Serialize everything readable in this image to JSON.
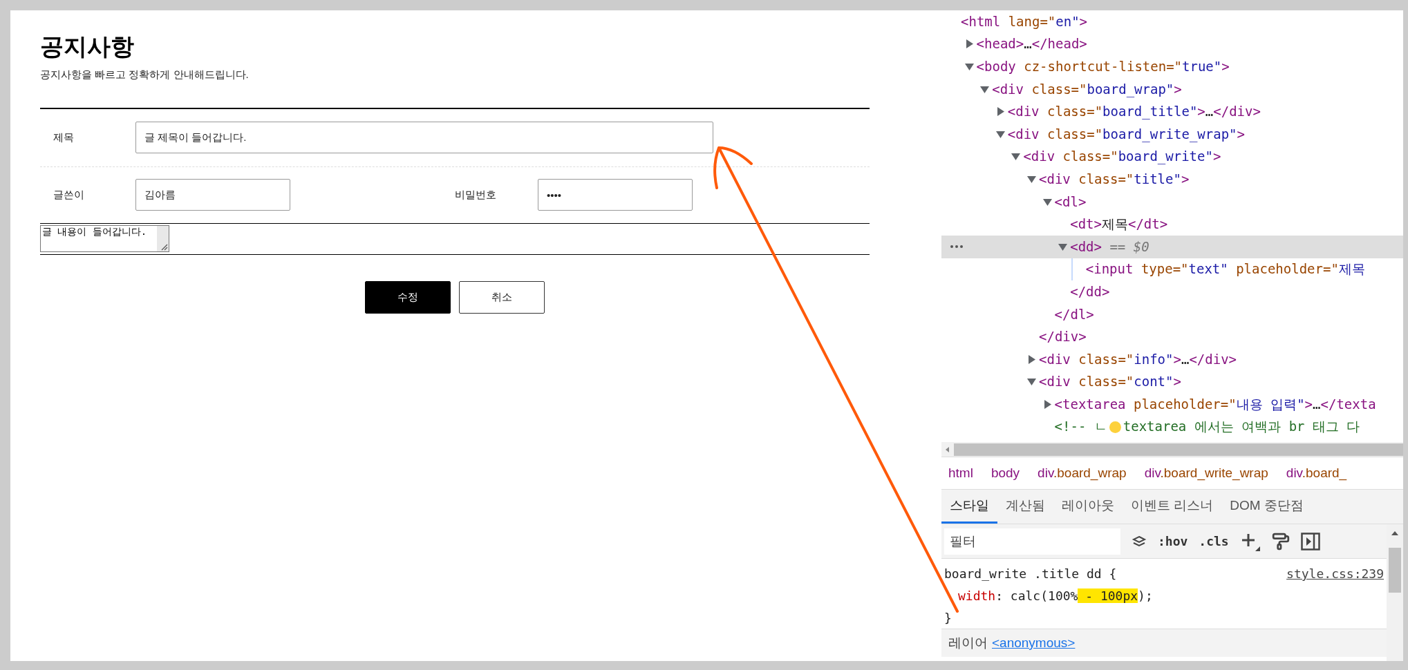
{
  "page": {
    "title": "공지사항",
    "subtitle": "공지사항을 빠르고 정확하게 안내해드립니다.",
    "title_field": {
      "label": "제목",
      "value": "글 제목이 들어갑니다."
    },
    "author_field": {
      "label": "글쓴이",
      "value": "김아름"
    },
    "password_field": {
      "label": "비밀번호",
      "value": "••••"
    },
    "content_field": {
      "value": "글 내용이 들어갑니다."
    },
    "buttons": [
      {
        "label": "수정",
        "kind": "primary"
      },
      {
        "label": "취소",
        "kind": "secondary"
      }
    ]
  },
  "devtools": {
    "dom_tree": [
      {
        "selected": false,
        "tokens": [
          {
            "kind": "tag",
            "text": "<html "
          },
          {
            "kind": "attr",
            "text": "lang=\""
          },
          {
            "kind": "val",
            "text": "en\""
          },
          {
            "kind": "tag",
            "text": ">"
          }
        ],
        "children": [
          {
            "selected": false,
            "expanded": false,
            "tokens": [
              {
                "kind": "tag",
                "text": "<head>"
              },
              {
                "kind": "text",
                "text": "…"
              },
              {
                "kind": "tag",
                "text": "</head>"
              }
            ]
          },
          {
            "selected": false,
            "expanded": true,
            "tokens": [
              {
                "kind": "tag",
                "text": "<body "
              },
              {
                "kind": "attr",
                "text": "cz-shortcut-listen=\""
              },
              {
                "kind": "val",
                "text": "true\""
              },
              {
                "kind": "tag",
                "text": ">"
              }
            ],
            "children": [
              {
                "selected": false,
                "expanded": true,
                "tokens": [
                  {
                    "kind": "tag",
                    "text": "<div "
                  },
                  {
                    "kind": "attr",
                    "text": "class=\""
                  },
                  {
                    "kind": "val",
                    "text": "board_wrap\""
                  },
                  {
                    "kind": "tag",
                    "text": ">"
                  }
                ],
                "children": [
                  {
                    "selected": false,
                    "expanded": false,
                    "tokens": [
                      {
                        "kind": "tag",
                        "text": "<div "
                      },
                      {
                        "kind": "attr",
                        "text": "class=\""
                      },
                      {
                        "kind": "val",
                        "text": "board_title\""
                      },
                      {
                        "kind": "tag",
                        "text": ">"
                      },
                      {
                        "kind": "text",
                        "text": "…"
                      },
                      {
                        "kind": "tag",
                        "text": "</div>"
                      }
                    ]
                  },
                  {
                    "selected": false,
                    "expanded": true,
                    "tokens": [
                      {
                        "kind": "tag",
                        "text": "<div "
                      },
                      {
                        "kind": "attr",
                        "text": "class=\""
                      },
                      {
                        "kind": "val",
                        "text": "board_write_wrap\""
                      },
                      {
                        "kind": "tag",
                        "text": ">"
                      }
                    ],
                    "children": [
                      {
                        "selected": false,
                        "expanded": true,
                        "tokens": [
                          {
                            "kind": "tag",
                            "text": "<div "
                          },
                          {
                            "kind": "attr",
                            "text": "class=\""
                          },
                          {
                            "kind": "val",
                            "text": "board_write\""
                          },
                          {
                            "kind": "tag",
                            "text": ">"
                          }
                        ],
                        "children": [
                          {
                            "selected": false,
                            "expanded": true,
                            "tokens": [
                              {
                                "kind": "tag",
                                "text": "<div "
                              },
                              {
                                "kind": "attr",
                                "text": "class=\""
                              },
                              {
                                "kind": "val",
                                "text": "title\""
                              },
                              {
                                "kind": "tag",
                                "text": ">"
                              }
                            ],
                            "closing": [
                              {
                                "kind": "tag",
                                "text": "</div>"
                              }
                            ],
                            "children": [
                              {
                                "selected": false,
                                "expanded": true,
                                "tokens": [
                                  {
                                    "kind": "tag",
                                    "text": "<dl>"
                                  }
                                ],
                                "closing": [
                                  {
                                    "kind": "tag",
                                    "text": "</dl>"
                                  }
                                ],
                                "children": [
                                  {
                                    "selected": false,
                                    "tokens": [
                                      {
                                        "kind": "tag",
                                        "text": "<dt>"
                                      },
                                      {
                                        "kind": "text",
                                        "text": "제목"
                                      },
                                      {
                                        "kind": "tag",
                                        "text": "</dt>"
                                      }
                                    ]
                                  },
                                  {
                                    "selected": true,
                                    "expanded": true,
                                    "tokens": [
                                      {
                                        "kind": "tag",
                                        "text": "<dd>"
                                      },
                                      {
                                        "kind": "dim",
                                        "text": " == $0"
                                      }
                                    ],
                                    "closing": [
                                      {
                                        "kind": "tag",
                                        "text": "</dd>"
                                      }
                                    ],
                                    "children": [
                                      {
                                        "selected": false,
                                        "tokens": [
                                          {
                                            "kind": "tag",
                                            "text": "<input "
                                          },
                                          {
                                            "kind": "attr",
                                            "text": "type=\""
                                          },
                                          {
                                            "kind": "val",
                                            "text": "text\""
                                          },
                                          {
                                            "kind": "attr",
                                            "text": " placeholder=\""
                                          },
                                          {
                                            "kind": "val",
                                            "text": "제목"
                                          }
                                        ]
                                      }
                                    ]
                                  }
                                ]
                              }
                            ]
                          },
                          {
                            "selected": false,
                            "expanded": false,
                            "tokens": [
                              {
                                "kind": "tag",
                                "text": "<div "
                              },
                              {
                                "kind": "attr",
                                "text": "class=\""
                              },
                              {
                                "kind": "val",
                                "text": "info\""
                              },
                              {
                                "kind": "tag",
                                "text": ">"
                              },
                              {
                                "kind": "text",
                                "text": "…"
                              },
                              {
                                "kind": "tag",
                                "text": "</div>"
                              }
                            ]
                          },
                          {
                            "selected": false,
                            "expanded": true,
                            "tokens": [
                              {
                                "kind": "tag",
                                "text": "<div "
                              },
                              {
                                "kind": "attr",
                                "text": "class=\""
                              },
                              {
                                "kind": "val",
                                "text": "cont\""
                              },
                              {
                                "kind": "tag",
                                "text": ">"
                              }
                            ],
                            "children": [
                              {
                                "selected": false,
                                "expanded": false,
                                "tokens": [
                                  {
                                    "kind": "tag",
                                    "text": "<textarea "
                                  },
                                  {
                                    "kind": "attr",
                                    "text": "placeholder=\""
                                  },
                                  {
                                    "kind": "val",
                                    "text": "내용 입력\""
                                  },
                                  {
                                    "kind": "tag",
                                    "text": ">"
                                  },
                                  {
                                    "kind": "text",
                                    "text": "…"
                                  },
                                  {
                                    "kind": "tag",
                                    "text": "</texta"
                                  }
                                ]
                              },
                              {
                                "selected": false,
                                "tokens": [
                                  {
                                    "kind": "comment",
                                    "text": "<!-- ㄴ"
                                  },
                                  {
                                    "kind": "dot"
                                  },
                                  {
                                    "kind": "comment",
                                    "text": "textarea 에서는 여백과 br 태그 다"
                                  }
                                ]
                              }
                            ]
                          }
                        ]
                      }
                    ]
                  }
                ]
              }
            ]
          }
        ]
      }
    ],
    "breadcrumbs": [
      {
        "tag": "html"
      },
      {
        "tag": "body"
      },
      {
        "tag": "div",
        "cls": ".board_wrap"
      },
      {
        "tag": "div",
        "cls": ".board_write_wrap"
      },
      {
        "tag": "div",
        "cls": ".board_"
      }
    ],
    "tabs": [
      {
        "label": "스타일",
        "selected": true
      },
      {
        "label": "계산됨",
        "selected": false
      },
      {
        "label": "레이아웃",
        "selected": false
      },
      {
        "label": "이벤트 리스너",
        "selected": false
      },
      {
        "label": "DOM 중단점",
        "selected": false
      }
    ],
    "filter": {
      "placeholder": "필터"
    },
    "toolbar": [
      ":hov",
      ".cls"
    ],
    "rule": {
      "selector": "board_write .title dd {",
      "source": "style.css:239",
      "declarations": [
        {
          "property": "width",
          "value_before": ": calc(100%",
          "highlighted": " - 100px",
          "value_after": ");"
        }
      ],
      "closing": "}"
    },
    "layer": {
      "label": "레이어",
      "link": "<anonymous>"
    }
  }
}
